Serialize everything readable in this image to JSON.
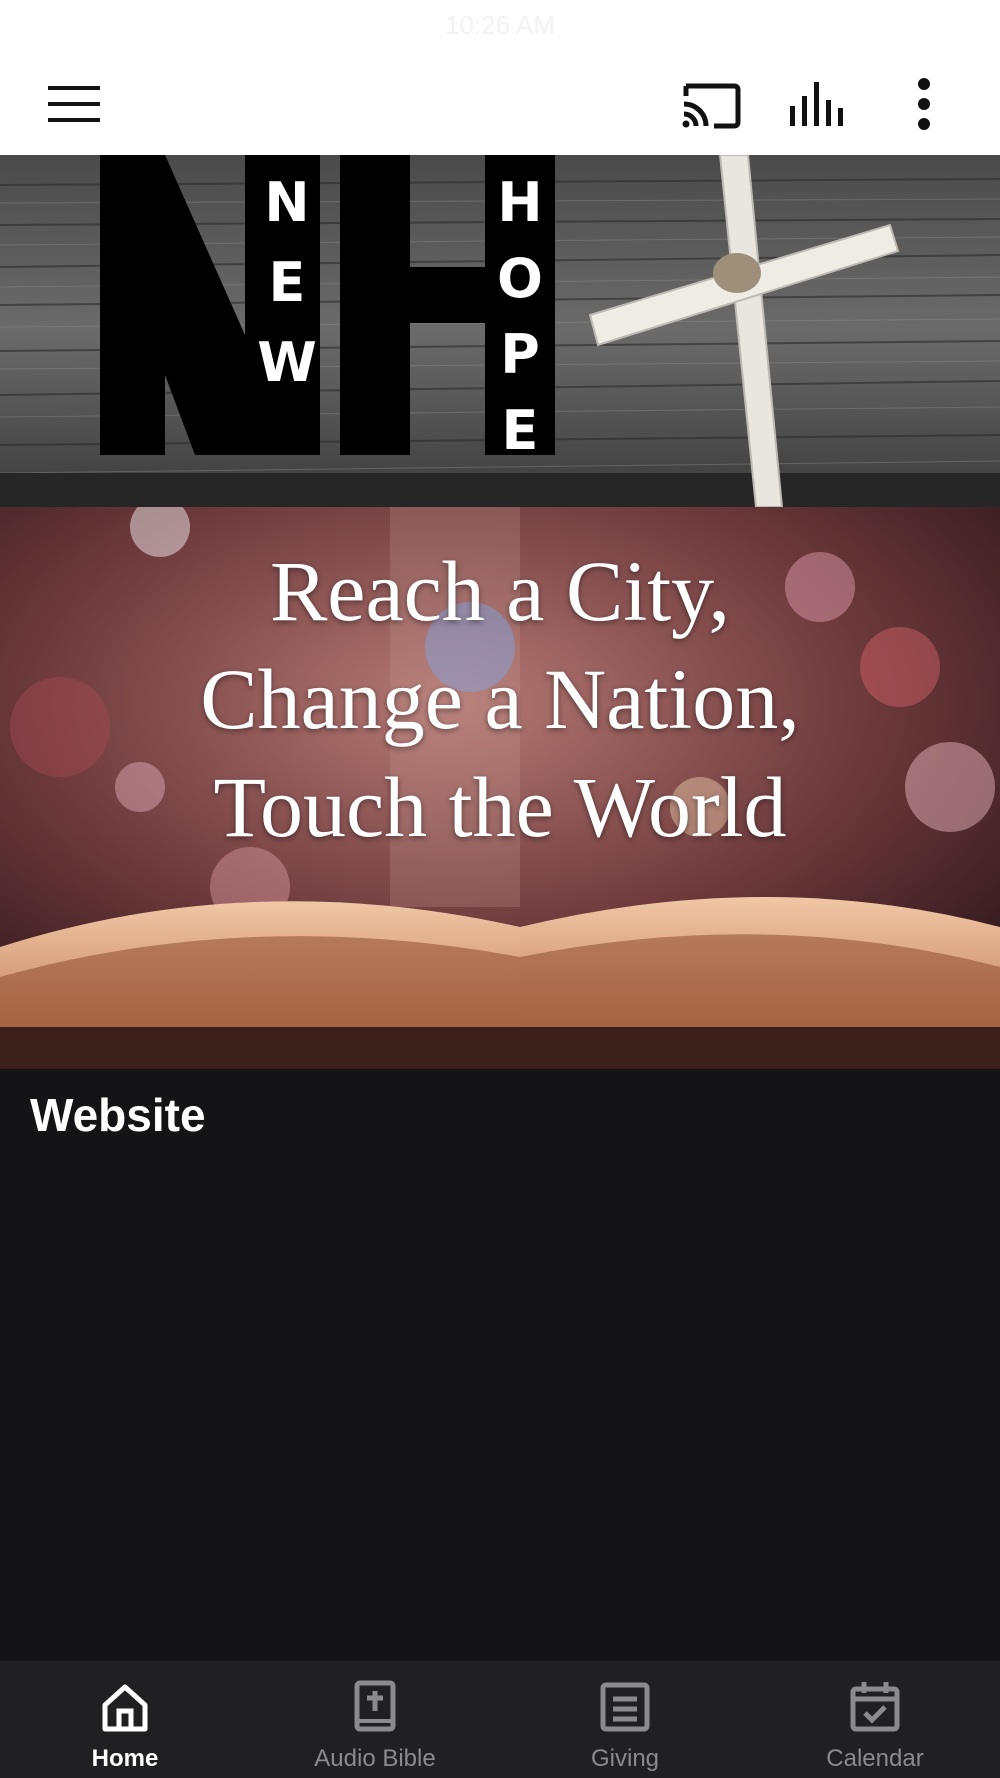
{
  "status_bar": {
    "time": "10:26 AM"
  },
  "app_bar": {
    "icons": [
      "menu-icon",
      "cast-icon",
      "audio-bars-icon",
      "more-vert-icon"
    ]
  },
  "logo_banner": {
    "letters": "NH",
    "word_left": "NEW",
    "word_right": "HOPE"
  },
  "hero_banner": {
    "lines": [
      "Reach a City,",
      "Change a Nation,",
      "Touch the World"
    ]
  },
  "section": {
    "title": "Website"
  },
  "bottom_nav": {
    "items": [
      {
        "label": "Home",
        "icon": "home-icon",
        "active": true
      },
      {
        "label": "Audio Bible",
        "icon": "bible-icon",
        "active": false
      },
      {
        "label": "Giving",
        "icon": "giving-icon",
        "active": false
      },
      {
        "label": "Calendar",
        "icon": "calendar-icon",
        "active": false
      }
    ]
  },
  "colors": {
    "page_background": "#141417",
    "app_bar_background": "#ffffff",
    "bottom_nav_background": "#202023",
    "nav_active": "#ffffff",
    "nav_inactive": "#8b8b8e"
  }
}
